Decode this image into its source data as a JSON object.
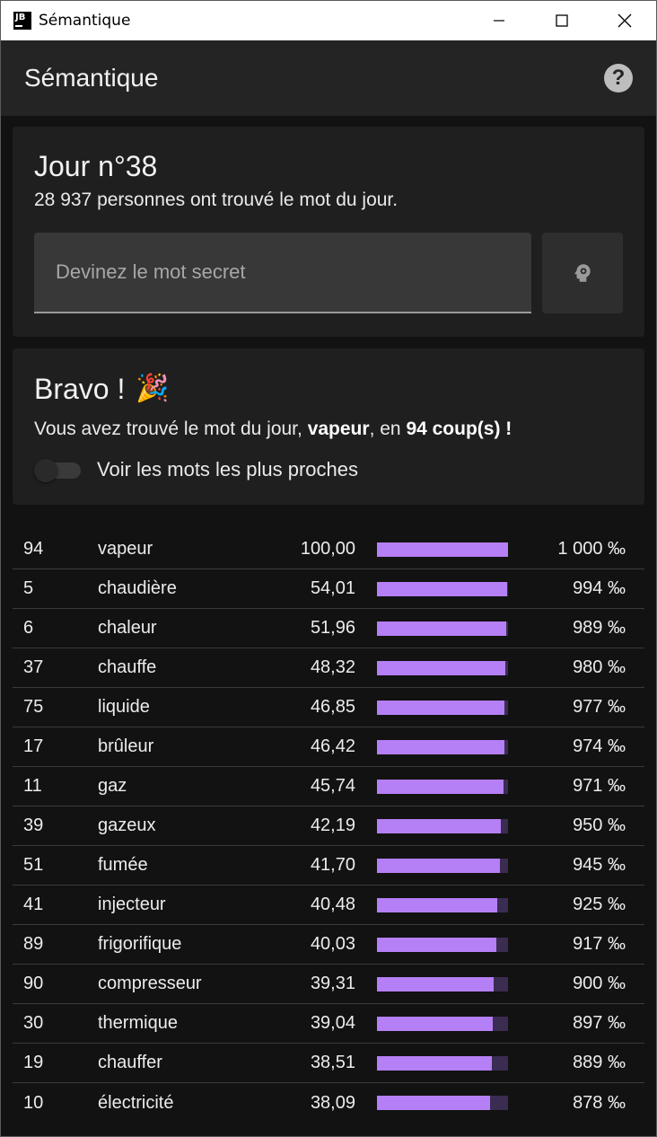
{
  "window": {
    "title": "Sémantique",
    "logo_text": "JB"
  },
  "appbar": {
    "title": "Sémantique",
    "help_icon": "?"
  },
  "day": {
    "title": "Jour n°38",
    "subtitle": "28 937 personnes ont trouvé le mot du jour.",
    "input_placeholder": "Devinez le mot secret",
    "input_value": "",
    "hint_icon": "brain-gear-icon"
  },
  "bravo": {
    "title": "Bravo !",
    "emoji": "🎉",
    "text_prefix": "Vous avez trouvé le mot du jour, ",
    "word": "vapeur",
    "text_middle": ", en ",
    "coups": "94 coup(s) !",
    "toggle_label": "Voir les mots les plus proches",
    "toggle_on": false
  },
  "colors": {
    "bar_fill": "#b57ff5",
    "bar_track": "#3b2c52"
  },
  "guesses": [
    {
      "num": "94",
      "word": "vapeur",
      "score": "100,00",
      "perm_value": 1000,
      "perm": "1 000 ‰"
    },
    {
      "num": "5",
      "word": "chaudière",
      "score": "54,01",
      "perm_value": 994,
      "perm": "994 ‰"
    },
    {
      "num": "6",
      "word": "chaleur",
      "score": "51,96",
      "perm_value": 989,
      "perm": "989 ‰"
    },
    {
      "num": "37",
      "word": "chauffe",
      "score": "48,32",
      "perm_value": 980,
      "perm": "980 ‰"
    },
    {
      "num": "75",
      "word": "liquide",
      "score": "46,85",
      "perm_value": 977,
      "perm": "977 ‰"
    },
    {
      "num": "17",
      "word": "brûleur",
      "score": "46,42",
      "perm_value": 974,
      "perm": "974 ‰"
    },
    {
      "num": "11",
      "word": "gaz",
      "score": "45,74",
      "perm_value": 971,
      "perm": "971 ‰"
    },
    {
      "num": "39",
      "word": "gazeux",
      "score": "42,19",
      "perm_value": 950,
      "perm": "950 ‰"
    },
    {
      "num": "51",
      "word": "fumée",
      "score": "41,70",
      "perm_value": 945,
      "perm": "945 ‰"
    },
    {
      "num": "41",
      "word": "injecteur",
      "score": "40,48",
      "perm_value": 925,
      "perm": "925 ‰"
    },
    {
      "num": "89",
      "word": "frigorifique",
      "score": "40,03",
      "perm_value": 917,
      "perm": "917 ‰"
    },
    {
      "num": "90",
      "word": "compresseur",
      "score": "39,31",
      "perm_value": 900,
      "perm": "900 ‰"
    },
    {
      "num": "30",
      "word": "thermique",
      "score": "39,04",
      "perm_value": 897,
      "perm": "897 ‰"
    },
    {
      "num": "19",
      "word": "chauffer",
      "score": "38,51",
      "perm_value": 889,
      "perm": "889 ‰"
    },
    {
      "num": "10",
      "word": "électricité",
      "score": "38,09",
      "perm_value": 878,
      "perm": "878 ‰"
    }
  ]
}
